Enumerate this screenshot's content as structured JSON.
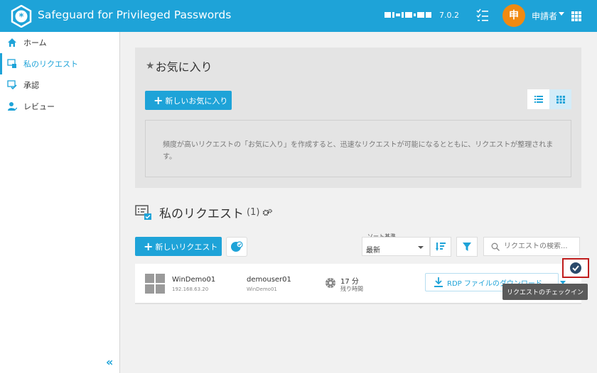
{
  "header": {
    "app_title": "Safeguard for Privileged Passwords",
    "version": "7.0.2",
    "avatar_initial": "申",
    "user_name": "申請者",
    "accent": "#1ea3d8",
    "avatar_color": "#f08a12",
    "icons": [
      "safeguard-logo-icon",
      "tasks-icon",
      "chevron-down-icon",
      "apps-grid-icon"
    ]
  },
  "sidebar": {
    "items": [
      {
        "label": "ホーム",
        "icon": "home-icon",
        "active": false
      },
      {
        "label": "私のリクエスト",
        "icon": "my-requests-icon",
        "active": true
      },
      {
        "label": "承認",
        "icon": "approvals-icon",
        "active": false
      },
      {
        "label": "レビュー",
        "icon": "review-icon",
        "active": false
      }
    ],
    "collapse_icon": "double-chevron-left-icon"
  },
  "favorites": {
    "title": "お気に入り",
    "new_button": "新しいお気に入り",
    "empty_text": "頻度が高いリクエストの「お気に入り」を作成すると、迅速なリクエストが可能になるとともに、リクエストが整理されます。",
    "view_modes": [
      "list-view-icon",
      "grid-view-icon"
    ],
    "selected_view": "grid"
  },
  "requests": {
    "title": "私のリクエスト",
    "count": "(1)",
    "new_button": "新しいリクエスト",
    "sort": {
      "label": "ソート基準",
      "value": "最新"
    },
    "search_placeholder": "リクエストの検索...",
    "items": [
      {
        "asset_name": "WinDemo01",
        "asset_ip": "192.168.63.20",
        "account_name": "demouser01",
        "account_asset": "WinDemo01",
        "time_value": "17 分",
        "time_label": "残り時間",
        "action_label": "RDP ファイルのダウンロード",
        "checkin_tooltip": "リクエストのチェックイン"
      }
    ]
  }
}
